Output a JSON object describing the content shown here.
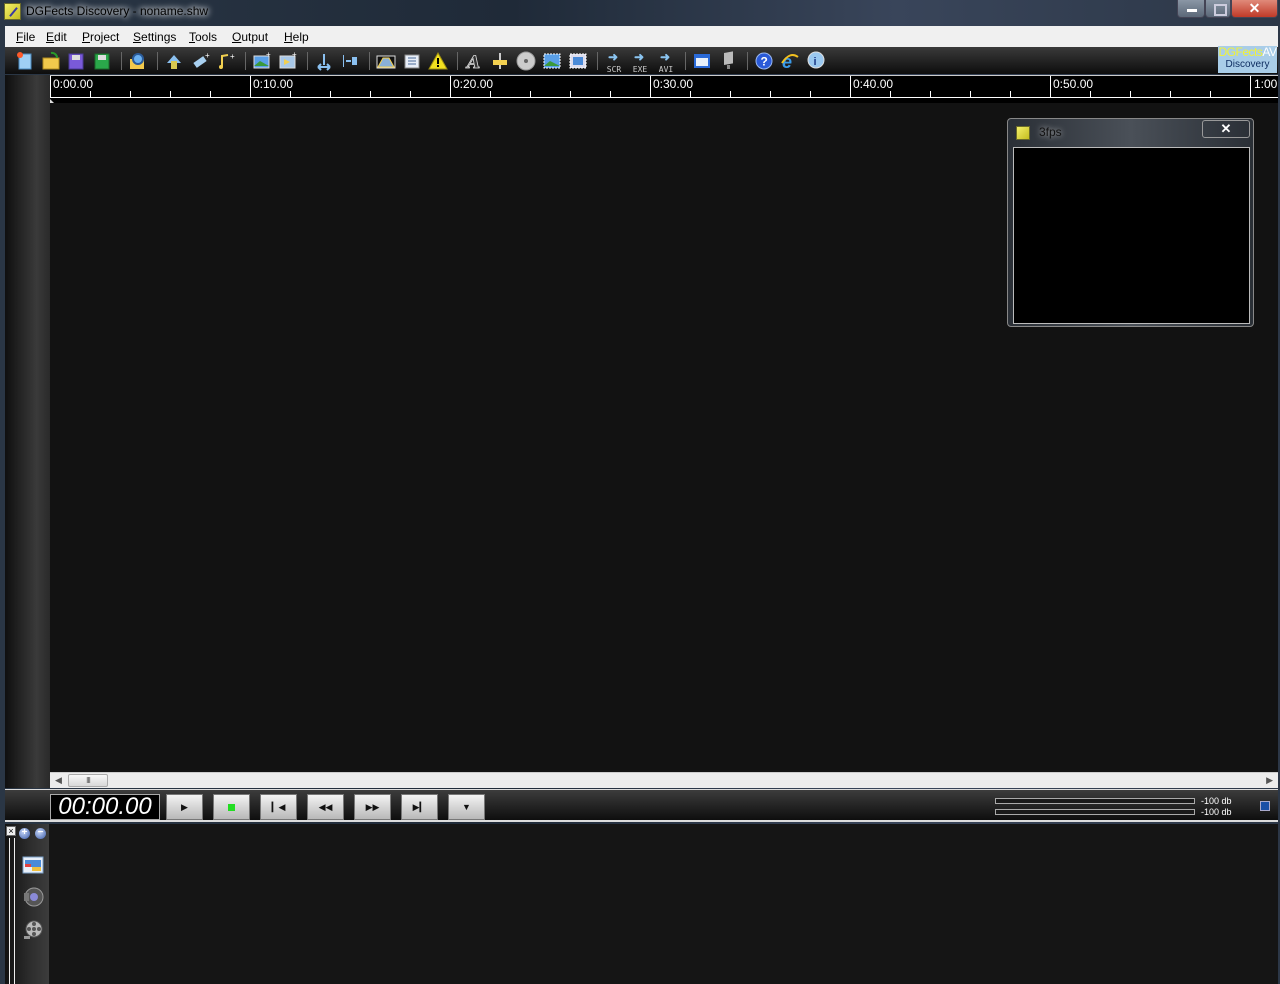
{
  "window": {
    "title": "DGFects Discovery - noname.shw",
    "close_label": "✕"
  },
  "menu": [
    {
      "label": "File",
      "accel": "F"
    },
    {
      "label": "Edit",
      "accel": "E"
    },
    {
      "label": "Project",
      "accel": "P"
    },
    {
      "label": "Settings",
      "accel": "S"
    },
    {
      "label": "Tools",
      "accel": "T"
    },
    {
      "label": "Output",
      "accel": "O"
    },
    {
      "label": "Help",
      "accel": "H"
    }
  ],
  "toolbar": {
    "buttons": [
      {
        "name": "new-project",
        "icon": "new-file-icon"
      },
      {
        "name": "open-project",
        "icon": "open-folder-icon"
      },
      {
        "name": "save-project",
        "icon": "save-icon"
      },
      {
        "name": "save-as-project",
        "icon": "save-as-icon"
      },
      {
        "name": "browse",
        "icon": "magnifier-icon"
      },
      {
        "name": "swap",
        "icon": "swap-icon"
      },
      {
        "name": "add-item",
        "icon": "add-tag-icon"
      },
      {
        "name": "add-music",
        "icon": "add-music-icon"
      },
      {
        "name": "add-image",
        "icon": "add-image-icon"
      },
      {
        "name": "add-effect",
        "icon": "add-effect-icon"
      },
      {
        "name": "stretch",
        "icon": "stretch-icon"
      },
      {
        "name": "align",
        "icon": "align-icon"
      },
      {
        "name": "envelope",
        "icon": "envelope-icon"
      },
      {
        "name": "list",
        "icon": "list-icon"
      },
      {
        "name": "warning",
        "icon": "warning-icon"
      },
      {
        "name": "text",
        "icon": "text-icon"
      },
      {
        "name": "level",
        "icon": "level-icon"
      },
      {
        "name": "disc",
        "icon": "disc-icon"
      },
      {
        "name": "image-frame",
        "icon": "image-frame-icon"
      },
      {
        "name": "film-frame",
        "icon": "film-frame-icon"
      },
      {
        "name": "export-scr",
        "icon": "export-arrow-icon",
        "text": "SCR"
      },
      {
        "name": "export-exe",
        "icon": "export-arrow-icon",
        "text": "EXE"
      },
      {
        "name": "export-avi",
        "icon": "export-arrow-icon",
        "text": "AVI"
      },
      {
        "name": "preview-window",
        "icon": "window-icon"
      },
      {
        "name": "screen",
        "icon": "screen-icon"
      },
      {
        "name": "help",
        "icon": "help-icon"
      },
      {
        "name": "web",
        "icon": "internet-explorer-icon"
      },
      {
        "name": "info",
        "icon": "info-icon"
      }
    ],
    "brand_line1": "DGFects",
    "brand_line1b": "AV",
    "brand_line2": "Discovery"
  },
  "ruler": {
    "labels": [
      "0:00.00",
      "0:10.00",
      "0:20.00",
      "0:30.00",
      "0:40.00",
      "0:50.00",
      "1:00"
    ]
  },
  "preview": {
    "title": "3fps",
    "close_label": "✕"
  },
  "transport": {
    "timecode": "00:00.00",
    "buttons": [
      "play",
      "stop",
      "go-to-start",
      "rewind",
      "fast-forward",
      "go-to-end",
      "more-options"
    ],
    "meter_left": "-100 db",
    "meter_right": "-100 db",
    "accent": "#1a4fa6"
  },
  "scroll": {
    "thumb_label": "III"
  },
  "bottom": {
    "close_label": "×",
    "zoom_in": "+",
    "zoom_out": "−"
  }
}
